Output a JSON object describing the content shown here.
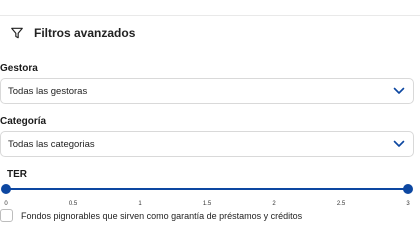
{
  "header": {
    "title": "Filtros avanzados",
    "icon": "filter-icon"
  },
  "gestora": {
    "label": "Gestora",
    "value": "Todas las gestoras",
    "icon": "chevron-down-icon"
  },
  "categoria": {
    "label": "Categoría",
    "value": "Todas las categorias",
    "icon": "chevron-down-icon"
  },
  "ter": {
    "label": "TER",
    "min": 0,
    "max": 3,
    "range": [
      0,
      3
    ],
    "ticks": [
      "0",
      "0.5",
      "1",
      "1.5",
      "2",
      "2.5",
      "3"
    ],
    "accent_color": "#0d47a1"
  },
  "pignorables": {
    "label": "Fondos pignorables que sirven como garantía de préstamos y créditos",
    "checked": false
  }
}
